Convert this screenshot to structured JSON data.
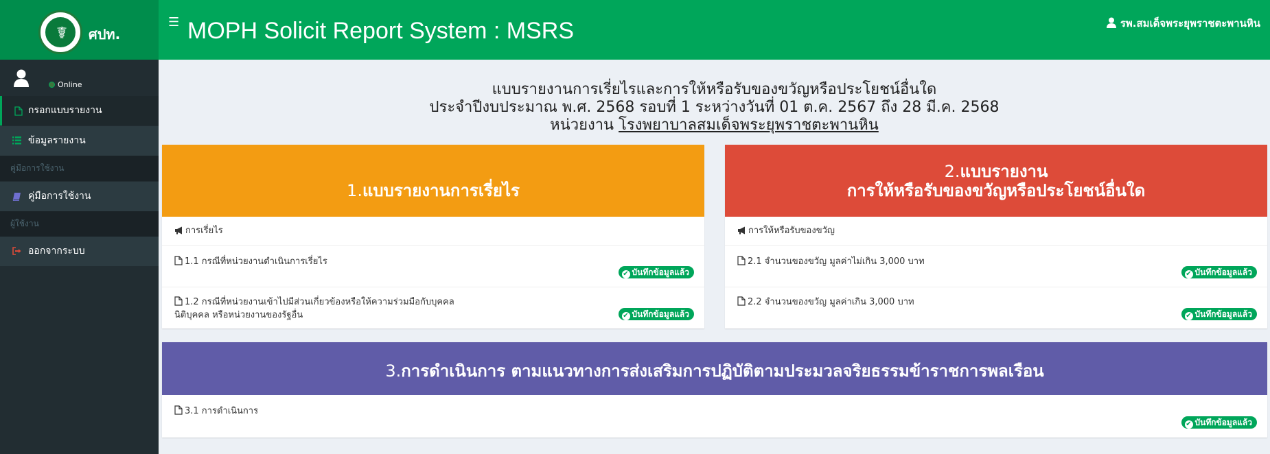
{
  "header": {
    "logo_text": "ศปท.",
    "app_title": "MOPH Solicit Report System : MSRS",
    "user_name": "รพ.สมเด็จพระยุพราชตะพานหิน",
    "colors": {
      "header": "#00a65a",
      "logo_bg": "#008d4c"
    }
  },
  "sidebar": {
    "status": "Online",
    "items": [
      {
        "label": "กรอกแบบรายงาน",
        "icon": "file-icon"
      },
      {
        "label": "ข้อมูลรายงาน",
        "icon": "list-icon"
      },
      {
        "label": "คู่มือการใช้งาน",
        "icon": "book-icon"
      },
      {
        "label": "ออกจากระบบ",
        "icon": "sign-out-icon"
      }
    ],
    "headers": [
      "คู่มือการใช้งาน",
      "ผู้ใช้งาน"
    ]
  },
  "main": {
    "heading_line1": "แบบรายงานการเรี่ยไรและการให้หรือรับของขวัญหรือประโยชน์อื่นใด",
    "heading_line2": "ประจำปีงบประมาณ พ.ศ. 2568 รอบที่ 1 ระหว่างวันที่ 01 ต.ค. 2567 ถึง 28 มี.ค. 2568",
    "heading_prefix": "หน่วยงาน",
    "heading_org": "โรงพยาบาลสมเด็จพระยุพราชตะพานหิน",
    "saved_label": "บันทึกข้อมูลแล้ว",
    "section1": {
      "number": "1.",
      "title": "แบบรายงานการเรี่ยไร",
      "subheader": "การเรี่ยไร",
      "items": [
        "1.1 กรณีที่หน่วยงานดำเนินการเรี่ยไร",
        "1.2 กรณีที่หน่วยงานเข้าไปมีส่วนเกี่ยวข้องหรือให้ความร่วมมือกับบุคคล",
        "นิติบุคคล หรือหน่วยงานของรัฐอื่น"
      ],
      "color": "#f39c12"
    },
    "section2": {
      "number": "2.",
      "title_line1": "แบบรายงาน",
      "title_line2": "การให้หรือรับของขวัญหรือประโยชน์อื่นใด",
      "subheader": "การให้หรือรับของขวัญ",
      "items": [
        "2.1 จำนวนของขวัญ มูลค่าไม่เกิน 3,000 บาท",
        "2.2 จำนวนของขวัญ มูลค่าเกิน 3,000 บาท"
      ],
      "color": "#dd4b39"
    },
    "section3": {
      "number": "3.",
      "title": "การดำเนินการ ตามแนวทางการส่งเสริมการปฏิบัติตามประมวลจริยธรรมข้าราชการพลเรือน",
      "items": [
        "3.1 การดำเนินการ"
      ],
      "color": "#605ca8"
    }
  }
}
